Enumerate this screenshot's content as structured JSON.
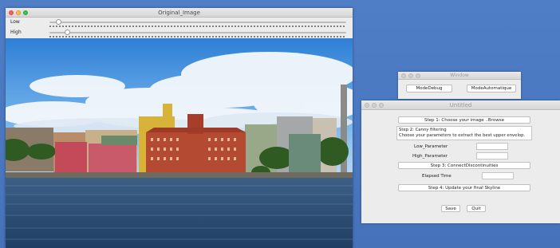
{
  "original_window": {
    "title": "Original_Image",
    "low_label": "Low",
    "high_label": "High",
    "low_value_fraction": 0.03,
    "high_value_fraction": 0.06,
    "photo": "stockholm-waterfront-photo"
  },
  "small_window": {
    "title": "Window",
    "mode_debug_label": "ModeDebug",
    "mode_auto_label": "ModeAutomatique"
  },
  "untitled_window": {
    "title": "Untitled",
    "step1_label": "Step 1: Choose your image ..Browse",
    "step2_line1": "Step 2: Canny filtering",
    "step2_line2": "Choose your parameters to extract the best upper envelop.",
    "low_parameter_label": "Low_Parameter",
    "high_parameter_label": "High_Parameter",
    "step3_label": "Step 3: ConnectDiscontinuities",
    "elapsed_time_label": "Elapsed Time",
    "step4_label": "Step 4: Update your final Skyline",
    "save_label": "Save",
    "quit_label": "Quit"
  }
}
